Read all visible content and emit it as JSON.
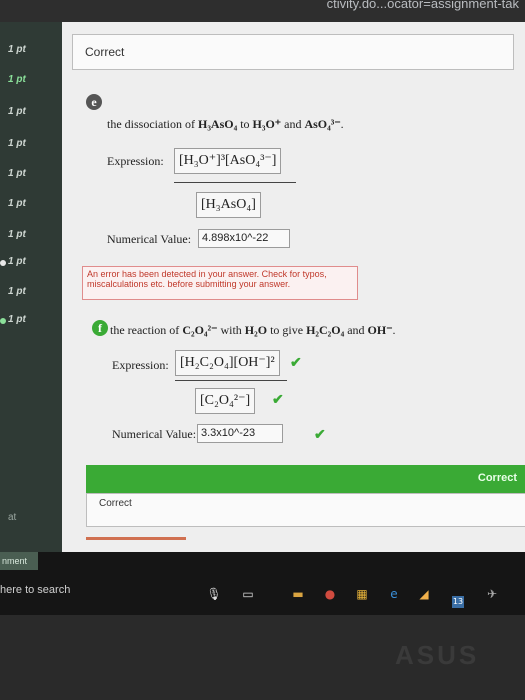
{
  "browser": {
    "url_fragment": "ctivity.do...ocator=assignment-tak"
  },
  "sidebar": {
    "points": [
      {
        "label": "1 pt",
        "active": false
      },
      {
        "label": "1 pt",
        "active": true
      },
      {
        "label": "1 pt",
        "active": false
      },
      {
        "label": "1 pt",
        "active": false
      },
      {
        "label": "1 pt",
        "active": false
      },
      {
        "label": "1 pt",
        "active": false
      },
      {
        "label": "1 pt",
        "active": false
      },
      {
        "label": "1 pt",
        "active": false
      },
      {
        "label": "1 pt",
        "active": false
      },
      {
        "label": "1 pt",
        "active": false
      }
    ],
    "footer_label": "at"
  },
  "top_feedback": {
    "label": "Correct"
  },
  "part_e": {
    "letter": "e",
    "question_prefix": "the dissociation of ",
    "reactant": "H₃AsO₄",
    "question_mid": " to ",
    "product1": "H₃O⁺",
    "question_and": " and ",
    "product2": "AsO₄³⁻",
    "question_end": ".",
    "expression_label": "Expression:",
    "numerator": "[H₃O⁺]³[AsO₄³⁻]",
    "denominator": "[H₃AsO₄]",
    "numerical_label": "Numerical Value:",
    "numerical_value": "4.898x10^-22",
    "error_text": "An error has been detected in your answer. Check for typos, miscalculations etc. before submitting your answer."
  },
  "part_f": {
    "letter": "f",
    "question_prefix": "the reaction of ",
    "reactant": "C₂O₄²⁻",
    "question_mid": " with ",
    "reactant2": "H₂O",
    "question_give": " to give ",
    "product1": "H₂C₂O₄",
    "question_and": " and ",
    "product2": "OH⁻",
    "question_end": ".",
    "expression_label": "Expression:",
    "numerator": "[H₂C₂O₄][OH⁻]²",
    "denominator": "[C₂O₄²⁻]",
    "numerical_label": "Numerical Value:",
    "numerical_value": "3.3x10^-23",
    "check": "✔"
  },
  "banner": {
    "label": "Correct"
  },
  "bottom_feedback": {
    "label": "Correct"
  },
  "taskbar": {
    "left_label": "nment",
    "search_text": "here to search",
    "badge_count": "13"
  },
  "bezel": {
    "brand": "ASUS"
  },
  "colors": {
    "accent_green": "#3aaa35",
    "error_red": "#c0392b",
    "sidebar": "#2f3a35"
  }
}
